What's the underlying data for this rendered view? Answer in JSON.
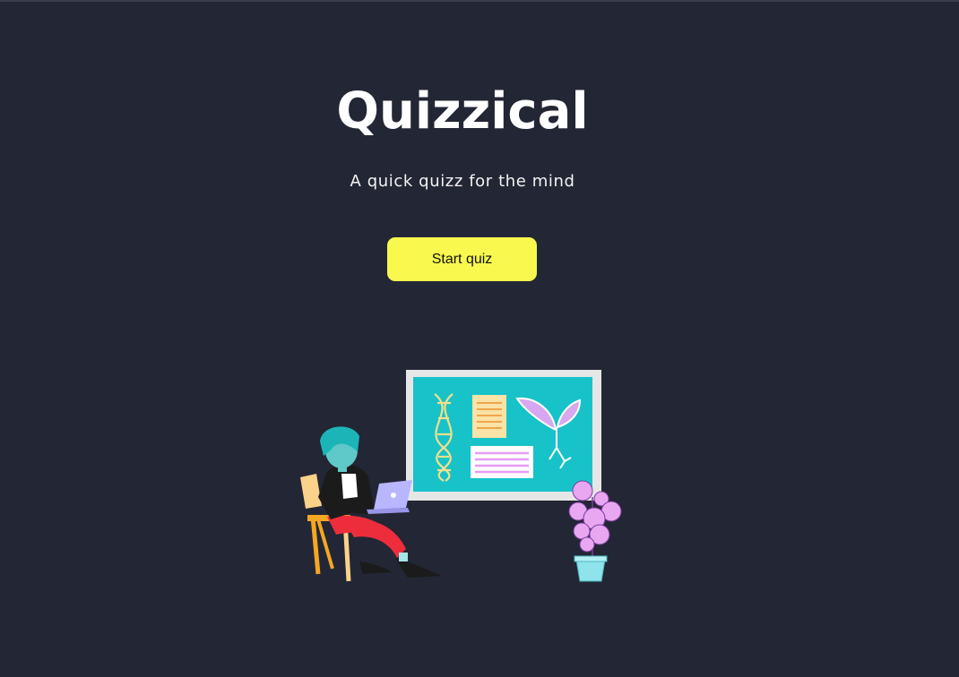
{
  "app": {
    "title": "Quizzical",
    "subtitle": "A quick quizz for the mind"
  },
  "actions": {
    "start_label": "Start quiz"
  },
  "colors": {
    "background": "#232634",
    "title": "#ffffff",
    "button": "#f8f84e",
    "button_text": "#111111"
  },
  "illustration": {
    "icon": "person-studying-with-laptop-illustration"
  }
}
